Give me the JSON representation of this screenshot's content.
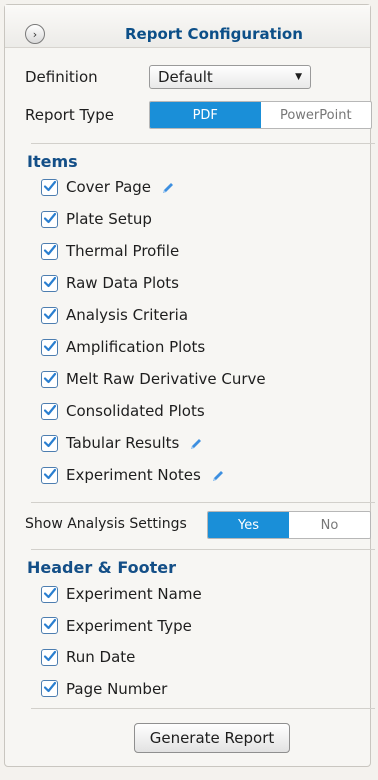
{
  "header": {
    "title": "Report Configuration",
    "collapse_glyph": "›"
  },
  "definition": {
    "label": "Definition",
    "value": "Default"
  },
  "report_type": {
    "label": "Report Type",
    "options": [
      "PDF",
      "PowerPoint"
    ],
    "selected": "PDF"
  },
  "items": {
    "heading": "Items",
    "list": [
      {
        "label": "Cover Page",
        "checked": true,
        "editable": true
      },
      {
        "label": "Plate Setup",
        "checked": true,
        "editable": false
      },
      {
        "label": "Thermal Profile",
        "checked": true,
        "editable": false
      },
      {
        "label": "Raw Data Plots",
        "checked": true,
        "editable": false
      },
      {
        "label": "Analysis Criteria",
        "checked": true,
        "editable": false
      },
      {
        "label": "Amplification Plots",
        "checked": true,
        "editable": false
      },
      {
        "label": "Melt Raw Derivative Curve",
        "checked": true,
        "editable": false
      },
      {
        "label": "Consolidated Plots",
        "checked": true,
        "editable": false
      },
      {
        "label": "Tabular Results",
        "checked": true,
        "editable": true
      },
      {
        "label": "Experiment Notes",
        "checked": true,
        "editable": true
      }
    ]
  },
  "analysis_settings": {
    "label": "Show Analysis Settings",
    "options": [
      "Yes",
      "No"
    ],
    "selected": "Yes"
  },
  "header_footer": {
    "heading": "Header & Footer",
    "list": [
      {
        "label": "Experiment Name",
        "checked": true
      },
      {
        "label": "Experiment Type",
        "checked": true
      },
      {
        "label": "Run Date",
        "checked": true
      },
      {
        "label": "Page Number",
        "checked": true
      }
    ]
  },
  "generate_button": {
    "label": "Generate Report"
  },
  "icons": {
    "check": "check-icon",
    "edit": "pencil-icon",
    "dropdown": "chevron-down-icon",
    "collapse": "collapse-arrow-icon"
  },
  "colors": {
    "accent": "#1a8fd8",
    "heading": "#144f87"
  }
}
